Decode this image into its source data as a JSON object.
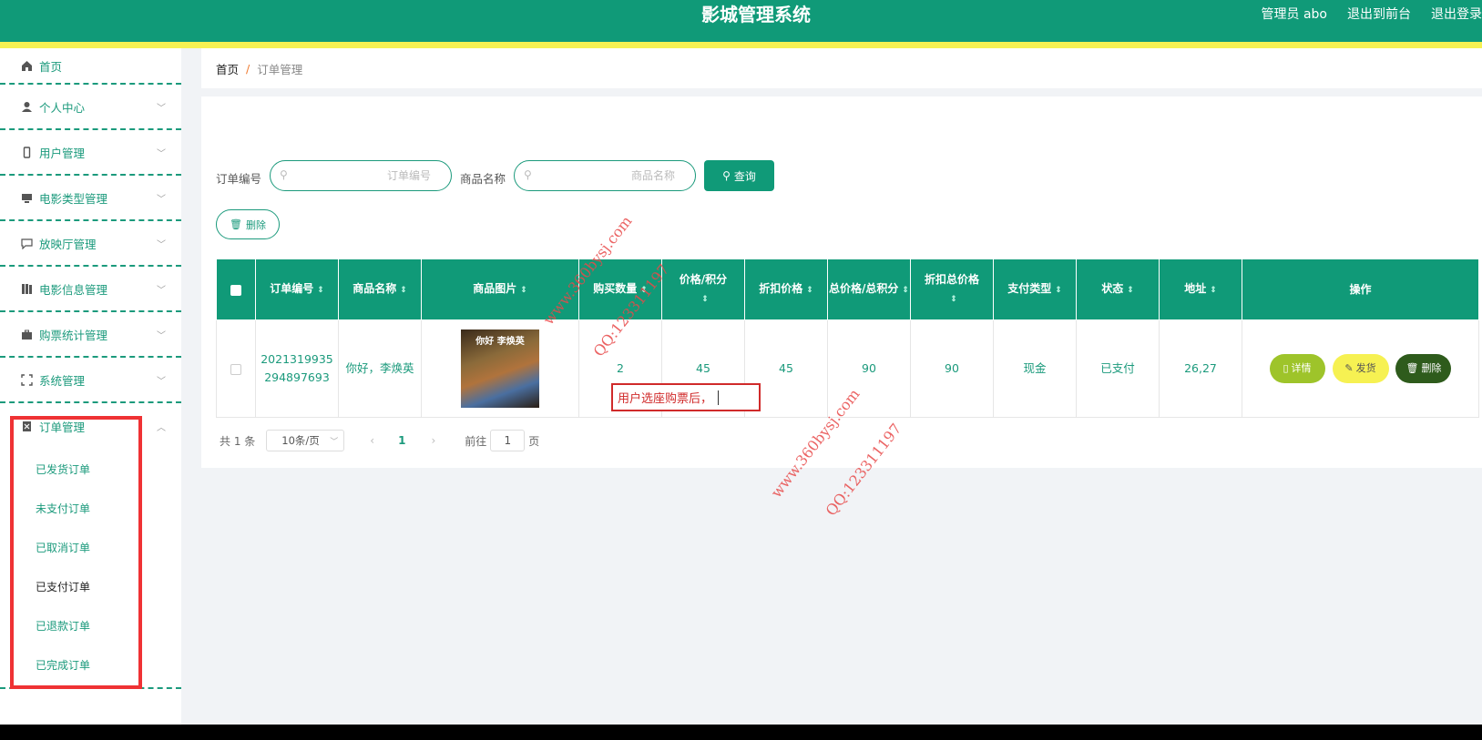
{
  "header": {
    "title": "影城管理系统",
    "links": [
      "管理员 abo",
      "退出到前台",
      "退出登录"
    ]
  },
  "sidebar": {
    "items": [
      {
        "label": "首页",
        "icon": "home-icon"
      },
      {
        "label": "个人中心",
        "icon": "user-icon"
      },
      {
        "label": "用户管理",
        "icon": "phone-icon"
      },
      {
        "label": "电影类型管理",
        "icon": "monitor-icon"
      },
      {
        "label": "放映厅管理",
        "icon": "chat-icon"
      },
      {
        "label": "电影信息管理",
        "icon": "book-icon"
      },
      {
        "label": "购票统计管理",
        "icon": "briefcase-icon"
      },
      {
        "label": "系统管理",
        "icon": "frame-icon"
      },
      {
        "label": "订单管理",
        "icon": "document-icon"
      }
    ],
    "submenu": [
      "已发货订单",
      "未支付订单",
      "已取消订单",
      "已支付订单",
      "已退款订单",
      "已完成订单"
    ],
    "active_submenu": "已支付订单"
  },
  "breadcrumb": {
    "home": "首页",
    "sep": "/",
    "current": "订单管理"
  },
  "search": {
    "order_no_label": "订单编号",
    "order_no_placeholder": "订单编号",
    "product_label": "商品名称",
    "product_placeholder": "商品名称",
    "query_button": "查询",
    "delete_button": "删除"
  },
  "table": {
    "headers": [
      "订单编号",
      "商品名称",
      "商品图片",
      "购买数量",
      "价格/积分",
      "折扣价格",
      "总价格/总积分",
      "折扣总价格",
      "支付类型",
      "状态",
      "地址",
      "操作"
    ],
    "rows": [
      {
        "order_no": "2021319935294897693",
        "order_no_line1": "2021319935",
        "order_no_line2": "294897693",
        "product_name": "你好，李焕英",
        "image_caption": "你好 李焕英",
        "quantity": "2",
        "price": "45",
        "discount_price": "45",
        "total": "90",
        "discount_total": "90",
        "pay_type": "现金",
        "status": "已支付",
        "address": "26,27"
      }
    ],
    "actions": {
      "detail": "详情",
      "ship": "发货",
      "delete": "删除"
    }
  },
  "pagination": {
    "total": "共 1 条",
    "page_size": "10条/页",
    "current_page": "1",
    "goto_label": "前往",
    "goto_value": "1",
    "page_suffix": "页"
  },
  "annotation": {
    "text": "用户选座购票后，"
  },
  "watermarks": [
    "www.360bysj.com",
    "QQ:123311197"
  ],
  "colors": {
    "primary": "#109a78",
    "accent": "#f6f152",
    "highlight": "#ef3234"
  }
}
